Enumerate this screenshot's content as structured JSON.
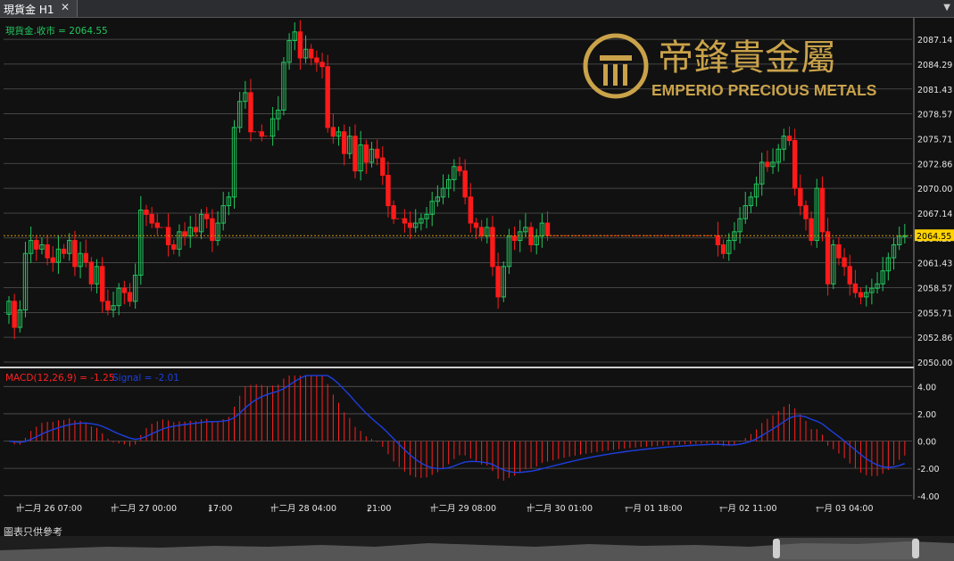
{
  "window": {
    "tab_title": "現貨金 H1",
    "close_glyph": "✕"
  },
  "price_label": "現貨金.收市 = 2064.55",
  "current_price_tag": "2064.55",
  "logo": {
    "chinese": "帝鋒貴金屬",
    "english": "EMPERIO PRECIOUS METALS"
  },
  "macd_label": "MACD(12,26,9) = -1.25",
  "signal_label": "Signal = -2.01",
  "footer_note": "圖表只供參考",
  "colors": {
    "up": "#22c55e",
    "down": "#ff1a1a",
    "grid": "#555555",
    "macd_hist": "#ff2020",
    "signal": "#1d3fe0",
    "price_tag": "#ffd200",
    "logo_gold": "#c9a24a"
  },
  "chart_data": [
    {
      "type": "candlestick",
      "series": [
        {
          "name": "現貨金.收市"
        }
      ],
      "ylim": [
        2050.0,
        2089.0
      ],
      "y_ticks": [
        "2087.14",
        "2084.29",
        "2081.43",
        "2078.57",
        "2075.71",
        "2072.86",
        "2070.00",
        "2067.14",
        "2064.29",
        "2061.43",
        "2058.57",
        "2055.71",
        "2052.86",
        "2050.00"
      ],
      "x_ticks": [
        "十二月 26 07:00",
        "十二月 27 00:00",
        "17:00",
        "十二月 28 04:00",
        "21:00",
        "十二月 29 08:00",
        "十二月 30 01:00",
        "一月 01 18:00",
        "一月 02 11:00",
        "一月 03 04:00"
      ],
      "last_close": 2064.55,
      "closes": [
        2057.0,
        2054.0,
        2056.0,
        2062.5,
        2064.0,
        2063.0,
        2063.5,
        2062.0,
        2061.5,
        2063.0,
        2062.5,
        2064.0,
        2061.0,
        2062.5,
        2061.5,
        2059.0,
        2061.0,
        2057.0,
        2056.0,
        2056.5,
        2058.5,
        2058.0,
        2057.0,
        2060.0,
        2067.5,
        2067.0,
        2066.0,
        2065.5,
        2065.5,
        2063.5,
        2063.0,
        2065.0,
        2064.5,
        2065.5,
        2065.0,
        2067.0,
        2066.5,
        2064.0,
        2066.0,
        2068.0,
        2069.0,
        2077.0,
        2080.0,
        2081.0,
        2076.5,
        2076.5,
        2076.0,
        2076.0,
        2078.0,
        2079.0,
        2084.5,
        2087.0,
        2088.0,
        2085.0,
        2086.0,
        2085.0,
        2084.5,
        2084.0,
        2077.0,
        2076.0,
        2076.5,
        2074.0,
        2076.0,
        2072.0,
        2075.0,
        2073.0,
        2074.5,
        2073.5,
        2071.5,
        2068.0,
        2066.5,
        2066.5,
        2066.0,
        2065.5,
        2066.0,
        2066.5,
        2067.0,
        2068.5,
        2069.0,
        2070.0,
        2071.0,
        2072.5,
        2072.0,
        2069.0,
        2066.0,
        2065.5,
        2064.5,
        2065.5,
        2061.0,
        2057.5,
        2061.0,
        2064.5,
        2064.0,
        2065.0,
        2065.5,
        2063.5,
        2064.5,
        2066.0,
        2064.55,
        2064.55,
        2064.55,
        2064.55,
        2064.55,
        2064.55,
        2064.55,
        2064.55,
        2064.55,
        2064.55,
        2064.55,
        2064.55,
        2064.55,
        2064.55,
        2064.55,
        2064.55,
        2064.55,
        2064.55,
        2064.55,
        2064.55,
        2064.55,
        2064.55,
        2064.55,
        2064.55,
        2064.55,
        2064.55,
        2064.55,
        2064.55,
        2064.55,
        2064.55,
        2064.55,
        2063.5,
        2062.5,
        2064.0,
        2065.0,
        2066.5,
        2068.0,
        2069.0,
        2070.5,
        2073.0,
        2072.5,
        2073.0,
        2074.5,
        2076.0,
        2075.5,
        2070.0,
        2068.0,
        2066.5,
        2064.0,
        2070.0,
        2065.0,
        2059.0,
        2063.5,
        2062.0,
        2061.0,
        2059.0,
        2058.0,
        2057.5,
        2058.0,
        2058.5,
        2059.0,
        2060.5,
        2062.0,
        2063.5,
        2064.5,
        2064.55
      ]
    },
    {
      "type": "bar",
      "series": [
        {
          "name": "MACD(12,26,9)"
        },
        {
          "name": "Signal"
        }
      ],
      "ylim": [
        -4.8,
        5.0
      ],
      "y_ticks": [
        "4.00",
        "2.00",
        "0.00",
        "-2.00",
        "-4.00"
      ],
      "values": [
        -1.25
      ],
      "signal_values": [
        -2.01
      ]
    }
  ]
}
